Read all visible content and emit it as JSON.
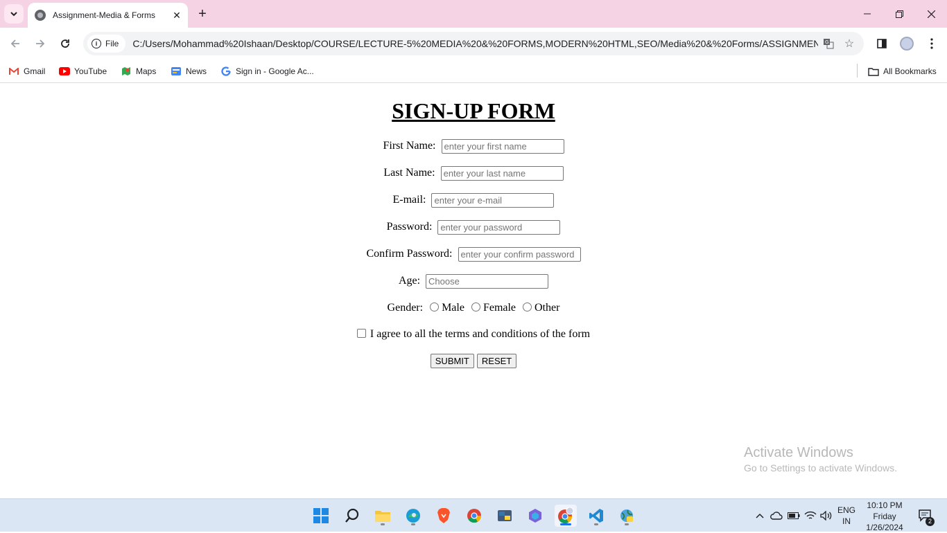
{
  "browser": {
    "tab_title": "Assignment-Media & Forms",
    "site_chip_label": "File",
    "url": "C:/Users/Mohammad%20Ishaan/Desktop/COURSE/LECTURE-5%20MEDIA%20&%20FORMS,MODERN%20HTML,SEO/Media%20&%20Forms/ASSIGNMENT/SO...",
    "bookmarks": [
      {
        "label": "Gmail",
        "icon": "gmail-icon",
        "color": "#ea4335"
      },
      {
        "label": "YouTube",
        "icon": "youtube-icon",
        "color": "#ff0000"
      },
      {
        "label": "Maps",
        "icon": "maps-icon",
        "color": "#34a853"
      },
      {
        "label": "News",
        "icon": "news-icon",
        "color": "#4285f4"
      },
      {
        "label": "Sign in - Google Ac...",
        "icon": "google-icon",
        "color": "#4285f4"
      }
    ],
    "all_bookmarks_label": "All Bookmarks"
  },
  "form": {
    "title": "SIGN-UP FORM",
    "first_name_label": "First Name:",
    "first_name_placeholder": "enter your first name",
    "last_name_label": "Last Name:",
    "last_name_placeholder": "enter your last name",
    "email_label": "E-mail:",
    "email_placeholder": "enter your e-mail",
    "password_label": "Password:",
    "password_placeholder": "enter your password",
    "confirm_label": "Confirm Password:",
    "confirm_placeholder": "enter your confirm password",
    "age_label": "Age:",
    "age_placeholder": "Choose",
    "gender_label": "Gender:",
    "gender_options": [
      "Male",
      "Female",
      "Other"
    ],
    "terms_label": "I agree to all the terms and conditions of the form",
    "submit_label": "SUBMIT",
    "reset_label": "RESET"
  },
  "watermark": {
    "title": "Activate Windows",
    "subtitle": "Go to Settings to activate Windows."
  },
  "taskbar": {
    "lang_line1": "ENG",
    "lang_line2": "IN",
    "time": "10:10 PM",
    "day": "Friday",
    "date": "1/26/2024",
    "notification_count": "2"
  },
  "colors": {
    "tabbar_bg": "#f6d3e4",
    "taskbar_bg": "#dbe6f4",
    "accent": "#1a73e8"
  }
}
